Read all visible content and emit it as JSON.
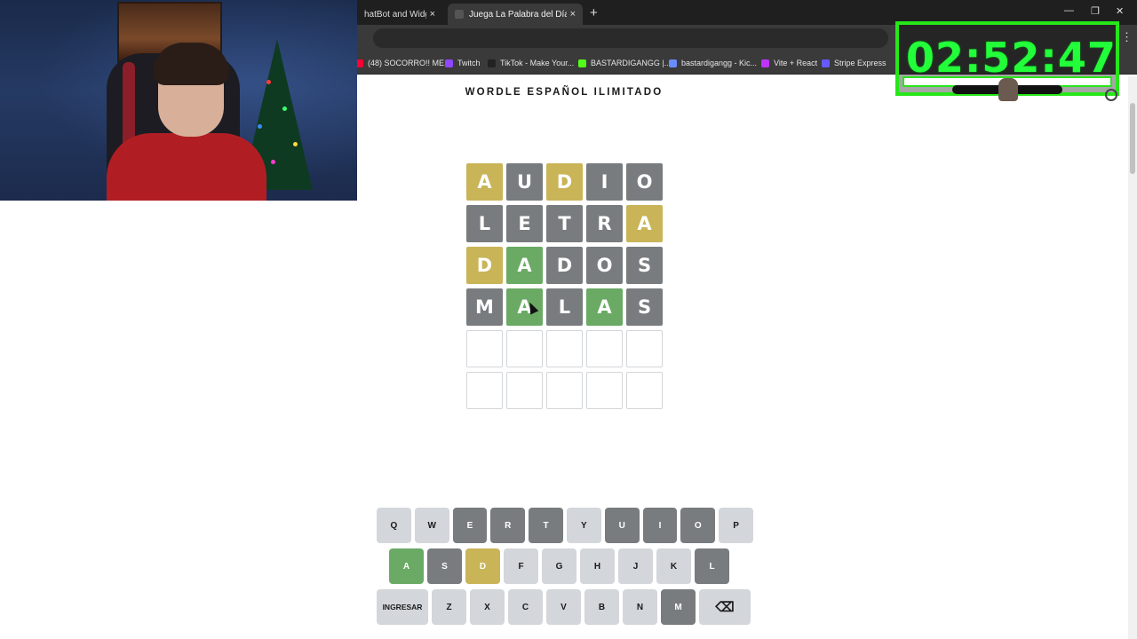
{
  "browser": {
    "tabs": [
      {
        "label": "hatBot and Widgets",
        "active": false
      },
      {
        "label": "Juega La Palabra del Día en Wo",
        "active": true
      }
    ],
    "close_glyph": "×",
    "new_tab_glyph": "+",
    "window_controls": [
      "—",
      "❐",
      "✕"
    ],
    "menu_glyph": "⋮",
    "bookmarks": [
      {
        "label": "(48) SOCORRO!! ME...",
        "icon": "youtube-icon",
        "color": "#ff0033"
      },
      {
        "label": "Twitch",
        "icon": "twitch-icon",
        "color": "#9146ff"
      },
      {
        "label": "TikTok - Make Your...",
        "icon": "tiktok-icon",
        "color": "#222222"
      },
      {
        "label": "BASTARDIGANGG |...",
        "icon": "kick-icon",
        "color": "#53fc18"
      },
      {
        "label": "bastardigangg - Kic...",
        "icon": "globe-icon",
        "color": "#6a8cff"
      },
      {
        "label": "Vite + React",
        "icon": "vite-icon",
        "color": "#bd34fe"
      },
      {
        "label": "Stripe Express",
        "icon": "stripe-icon",
        "color": "#635bff"
      }
    ]
  },
  "overlay": {
    "timer": "02:52:47",
    "accent_color": "#27e619"
  },
  "page": {
    "title": "WORDLE ESPAÑOL ILIMITADO"
  },
  "board": {
    "rows": [
      [
        {
          "l": "A",
          "s": "present"
        },
        {
          "l": "U",
          "s": "absent"
        },
        {
          "l": "D",
          "s": "present"
        },
        {
          "l": "I",
          "s": "absent"
        },
        {
          "l": "O",
          "s": "absent"
        }
      ],
      [
        {
          "l": "L",
          "s": "absent"
        },
        {
          "l": "E",
          "s": "absent"
        },
        {
          "l": "T",
          "s": "absent"
        },
        {
          "l": "R",
          "s": "absent"
        },
        {
          "l": "A",
          "s": "present"
        }
      ],
      [
        {
          "l": "D",
          "s": "present"
        },
        {
          "l": "A",
          "s": "correct"
        },
        {
          "l": "D",
          "s": "absent"
        },
        {
          "l": "O",
          "s": "absent"
        },
        {
          "l": "S",
          "s": "absent"
        }
      ],
      [
        {
          "l": "M",
          "s": "absent"
        },
        {
          "l": "A",
          "s": "correct"
        },
        {
          "l": "L",
          "s": "absent"
        },
        {
          "l": "A",
          "s": "correct"
        },
        {
          "l": "S",
          "s": "absent"
        }
      ],
      [
        {
          "l": "",
          "s": "empty"
        },
        {
          "l": "",
          "s": "empty"
        },
        {
          "l": "",
          "s": "empty"
        },
        {
          "l": "",
          "s": "empty"
        },
        {
          "l": "",
          "s": "empty"
        }
      ],
      [
        {
          "l": "",
          "s": "empty"
        },
        {
          "l": "",
          "s": "empty"
        },
        {
          "l": "",
          "s": "empty"
        },
        {
          "l": "",
          "s": "empty"
        },
        {
          "l": "",
          "s": "empty"
        }
      ]
    ],
    "colors": {
      "correct": "#6aaa64",
      "present": "#c9b458",
      "absent": "#787c7e"
    }
  },
  "keyboard": {
    "rows": [
      [
        {
          "k": "Q",
          "s": "unused"
        },
        {
          "k": "W",
          "s": "unused"
        },
        {
          "k": "E",
          "s": "absent"
        },
        {
          "k": "R",
          "s": "absent"
        },
        {
          "k": "T",
          "s": "absent"
        },
        {
          "k": "Y",
          "s": "unused"
        },
        {
          "k": "U",
          "s": "absent"
        },
        {
          "k": "I",
          "s": "absent"
        },
        {
          "k": "O",
          "s": "absent"
        },
        {
          "k": "P",
          "s": "unused"
        }
      ],
      [
        {
          "k": "A",
          "s": "correct"
        },
        {
          "k": "S",
          "s": "absent"
        },
        {
          "k": "D",
          "s": "present"
        },
        {
          "k": "F",
          "s": "unused"
        },
        {
          "k": "G",
          "s": "unused"
        },
        {
          "k": "H",
          "s": "unused"
        },
        {
          "k": "J",
          "s": "unused"
        },
        {
          "k": "K",
          "s": "unused"
        },
        {
          "k": "L",
          "s": "absent"
        }
      ],
      [
        {
          "k": "INGRESAR",
          "s": "unused",
          "wide": true
        },
        {
          "k": "Z",
          "s": "unused"
        },
        {
          "k": "X",
          "s": "unused"
        },
        {
          "k": "C",
          "s": "unused"
        },
        {
          "k": "V",
          "s": "unused"
        },
        {
          "k": "B",
          "s": "unused"
        },
        {
          "k": "N",
          "s": "unused"
        },
        {
          "k": "M",
          "s": "absent"
        },
        {
          "k": "⌫",
          "s": "unused",
          "back": true
        }
      ]
    ]
  }
}
